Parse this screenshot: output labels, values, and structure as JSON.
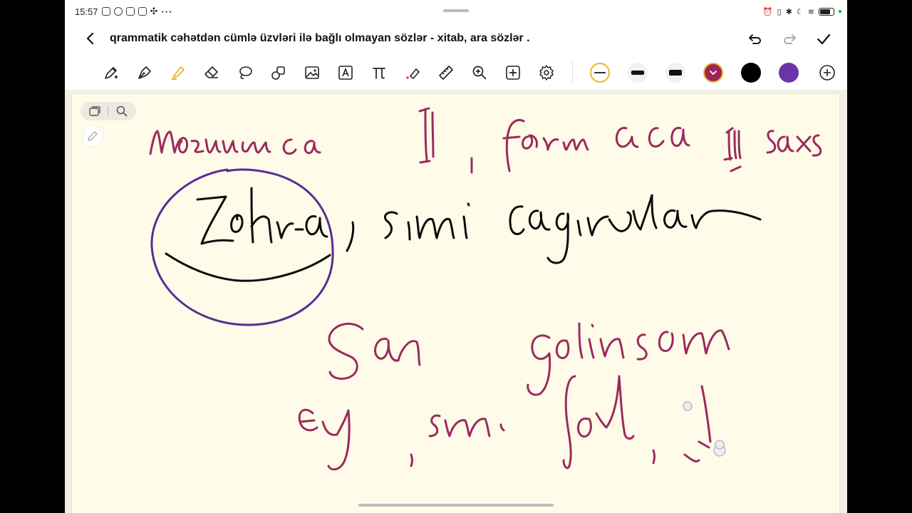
{
  "status_bar": {
    "time": "15:57",
    "more": "···"
  },
  "document": {
    "title": "qrammatik cəhətdən cümlə üzvləri ilə bağlı olmayan sözlər - xitab, ara sözlər ."
  },
  "title_actions": {
    "back_icon": "chevron-left-icon",
    "undo_icon": "undo-icon",
    "redo_icon": "redo-icon",
    "done_icon": "check-icon"
  },
  "toolbar": {
    "tools": [
      "pen-ai-icon",
      "fountain-pen-icon",
      "highlighter-icon",
      "eraser-icon",
      "lasso-icon",
      "shapes-icon",
      "image-icon",
      "text-box-icon",
      "math-icon",
      "laser-pointer-icon",
      "ruler-icon",
      "zoom-icon",
      "add-icon",
      "settings-icon"
    ],
    "active_tool": "highlighter-icon",
    "swatches": [
      "#ffffff",
      "#000000",
      "#000000",
      "#a0235a",
      "#000000",
      "#6a35a8"
    ],
    "active_swatch": "#a0235a"
  },
  "colors": {
    "ink_magenta": "#9b2a5e",
    "ink_black": "#0b0b0b",
    "ink_purple": "#5a2d94",
    "paper": "#fefbe9",
    "highlight_yellow": "#e8b92b"
  }
}
